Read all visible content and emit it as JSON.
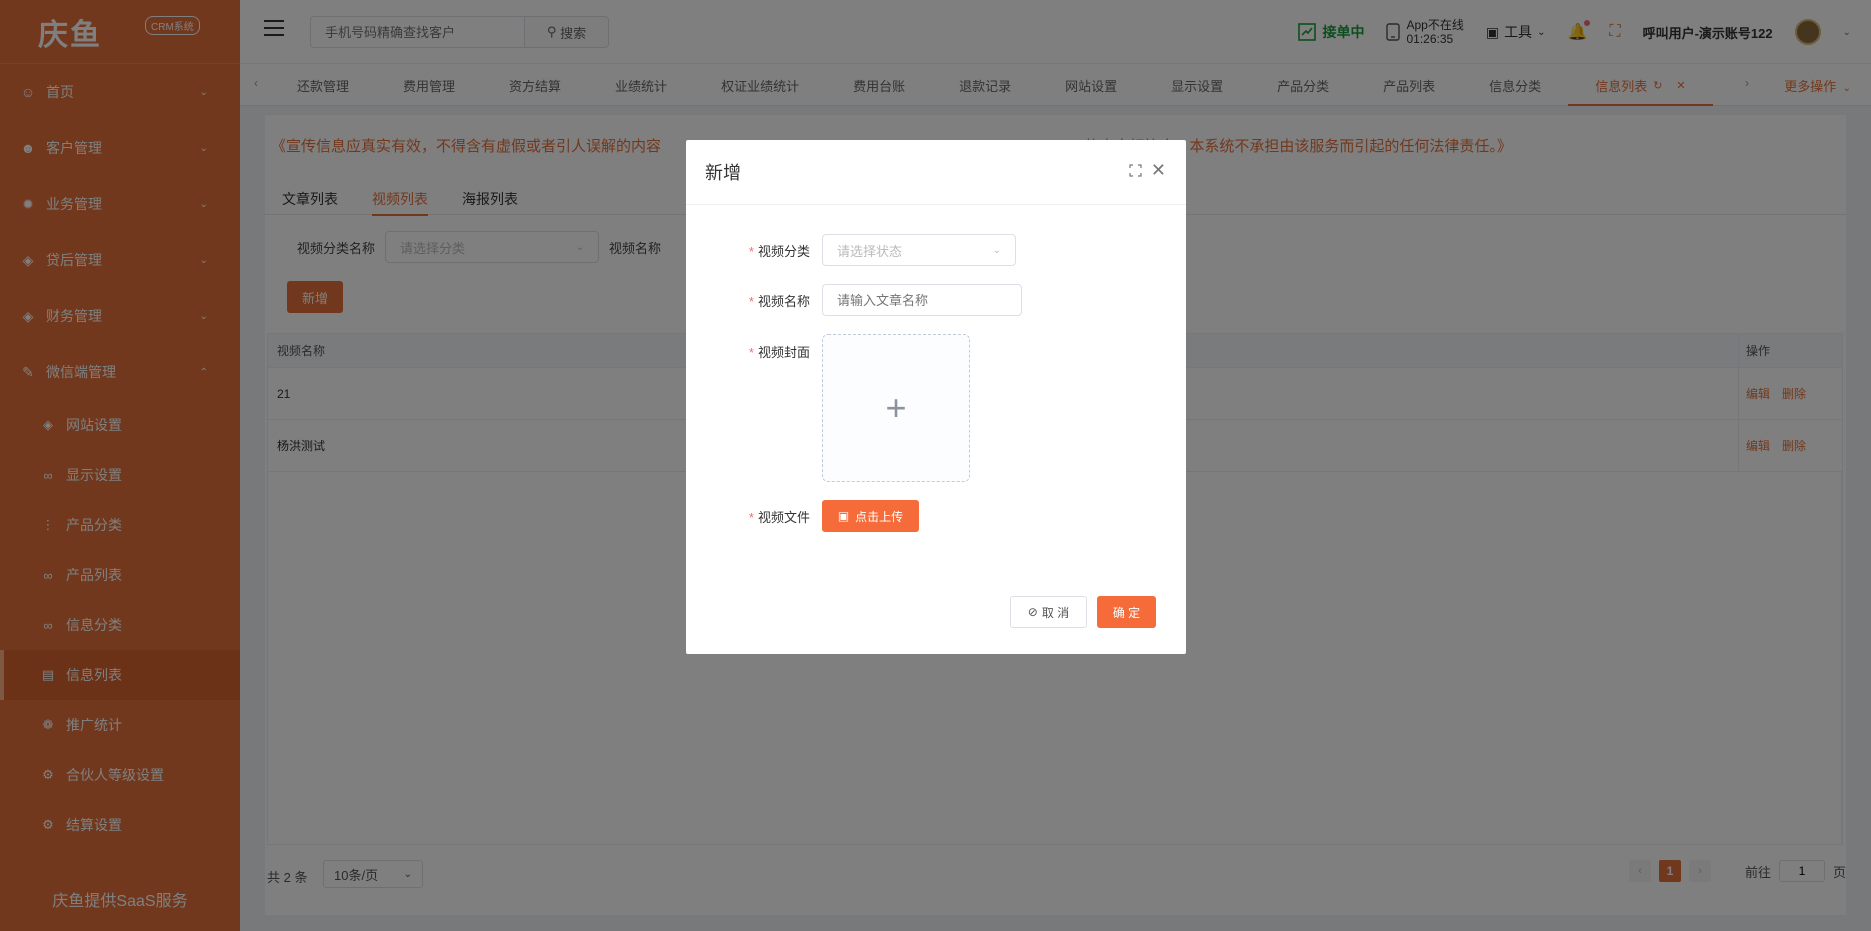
{
  "app": {
    "logo_text": "庆鱼",
    "logo_badge": "CRM系统",
    "footer": "庆鱼提供SaaS服务"
  },
  "sidebar": {
    "items": [
      {
        "label": "首页",
        "icon": "user-icon"
      },
      {
        "label": "客户管理",
        "icon": "users-icon"
      },
      {
        "label": "业务管理",
        "icon": "bug-icon"
      },
      {
        "label": "贷后管理",
        "icon": "tag-icon"
      },
      {
        "label": "财务管理",
        "icon": "tag-icon"
      },
      {
        "label": "微信端管理",
        "icon": "edit-icon"
      }
    ],
    "subitems": [
      {
        "label": "网站设置",
        "icon": "tag-icon"
      },
      {
        "label": "显示设置",
        "icon": "glasses-icon"
      },
      {
        "label": "产品分类",
        "icon": "chart-icon"
      },
      {
        "label": "产品列表",
        "icon": "glasses-icon"
      },
      {
        "label": "信息分类",
        "icon": "glasses-icon"
      },
      {
        "label": "信息列表",
        "icon": "book-icon"
      },
      {
        "label": "推广统计",
        "icon": "gear-icon"
      },
      {
        "label": "合伙人等级设置",
        "icon": "gear-icon"
      },
      {
        "label": "结算设置",
        "icon": "gear-icon"
      }
    ]
  },
  "header": {
    "search_placeholder": "手机号码精确查找客户",
    "search_button": "搜索",
    "accept_status": "接单中",
    "app_status": "App不在线",
    "app_time": "01:26:35",
    "tools": "工具",
    "user": "呼叫用户-演示账号122"
  },
  "tabs": {
    "items": [
      "还款管理",
      "费用管理",
      "资方结算",
      "业绩统计",
      "权证业绩统计",
      "费用台账",
      "退款记录",
      "网站设置",
      "显示设置",
      "产品分类",
      "产品列表",
      "信息分类",
      "信息列表"
    ],
    "active_index": 12,
    "more": "更多操作"
  },
  "content": {
    "notice": "《宣传信息应真实有效，不得含有虚假或者引人误解的内容，内容中所展示的产品信息应与实际产品的功能、性能、用途等内容相符合；本系统不承担由该服务而引起的任何法律责任。》",
    "notice_visible_left": "《宣传信息应真实有效，不得含有虚假或者引人误解的内容",
    "notice_visible_right": "的内容相符合；本系统不承担由该服务而引起的任何法律责任。》",
    "subtabs": [
      "文章列表",
      "视频列表",
      "海报列表"
    ],
    "filter_category_label": "视频分类名称",
    "filter_category_placeholder": "请选择分类",
    "filter_name_label": "视频名称",
    "add_button": "新增",
    "table": {
      "columns": [
        "视频名称",
        "操作"
      ],
      "rows": [
        {
          "name": "21",
          "edit": "编辑",
          "delete": "删除"
        },
        {
          "name": "杨洪测试",
          "edit": "编辑",
          "delete": "删除"
        }
      ]
    },
    "pager": {
      "total": "共 2 条",
      "page_size": "10条/页",
      "current": "1",
      "goto_label": "前往",
      "goto_value": "1",
      "page_unit": "页"
    }
  },
  "modal": {
    "title": "新增",
    "fields": {
      "category_label": "视频分类",
      "category_placeholder": "请选择状态",
      "name_label": "视频名称",
      "name_placeholder": "请输入文章名称",
      "cover_label": "视频封面",
      "file_label": "视频文件",
      "upload_button": "点击上传"
    },
    "cancel": "取 消",
    "confirm": "确 定"
  },
  "colors": {
    "brand": "#e5713a",
    "accept_green": "#1a9c3c",
    "primary_button": "#f56c3a"
  }
}
